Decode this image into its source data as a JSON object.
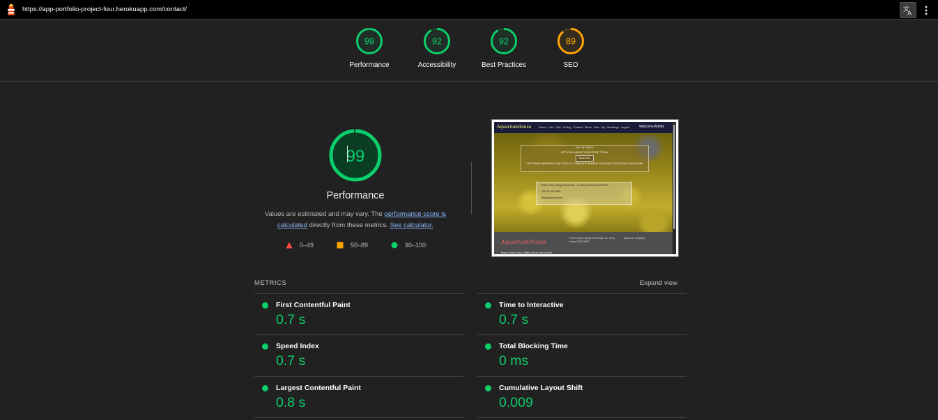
{
  "browser": {
    "url": "https://app-portfolio-project-four.herokuapp.com/contact/",
    "translate_icon": "translate-icon",
    "more_icon": "more-vert-icon",
    "logo_icon": "lighthouse-icon"
  },
  "summary": {
    "gauges": [
      {
        "score": "99",
        "score_value": 99,
        "label": "Performance",
        "color": "#0cce6b"
      },
      {
        "score": "92",
        "score_value": 92,
        "label": "Accessibility",
        "color": "#0cce6b"
      },
      {
        "score": "92",
        "score_value": 92,
        "label": "Best Practices",
        "color": "#0cce6b"
      },
      {
        "score": "89",
        "score_value": 89,
        "label": "SEO",
        "color": "#ffa400"
      }
    ]
  },
  "performance": {
    "score": "99",
    "score_value": 99,
    "title": "Performance",
    "description_prefix": "Values are estimated and may vary. The ",
    "link1": "performance score is calculated",
    "description_mid": " directly from these metrics. ",
    "link2": "See calculator.",
    "legend": [
      {
        "range": "0–49",
        "shape": "triangle",
        "color": "#ff4e42"
      },
      {
        "range": "50–89",
        "shape": "square",
        "color": "#ffa400"
      },
      {
        "range": "90–100",
        "shape": "circle",
        "color": "#0cce6b"
      }
    ]
  },
  "thumbnail": {
    "brand": "AquariumHouse",
    "nav_links": "About  Let's Pay  Prolog  Contact  Book Now  My Bookings  Logout",
    "welcome": "Welcome Admin",
    "hero_line1": "GET IN TOUCH",
    "hero_line2": "LET'S TALK ABOUT YOUR EVENT TODAY",
    "hero_button": "Book Now",
    "hero_line3": "CAPTURING MEMORIES ONE CLICK AT A TIME WITH SHARKS, DOLPHINS, CROCODILES AND MORE",
    "address": "Fedex Kerry College Removals · Co. Kerry, Ireland V93 FWE3",
    "phone": "+353 87 000 0000",
    "email": "info@aquarium.com",
    "footer_brand": "AquariumHouse",
    "footer_address": "Fedex Kerry College Removals, Co. Kerry, Ireland V93 FWE3",
    "footer_about": "About the company",
    "footer_links": "Home | Book Now | Gallery | Book Now | About"
  },
  "metrics": {
    "header": "METRICS",
    "expand": "Expand view",
    "items": [
      {
        "name": "First Contentful Paint",
        "value": "0.7 s"
      },
      {
        "name": "Time to Interactive",
        "value": "0.7 s"
      },
      {
        "name": "Speed Index",
        "value": "0.7 s"
      },
      {
        "name": "Total Blocking Time",
        "value": "0 ms"
      },
      {
        "name": "Largest Contentful Paint",
        "value": "0.8 s"
      },
      {
        "name": "Cumulative Layout Shift",
        "value": "0.009"
      }
    ]
  }
}
